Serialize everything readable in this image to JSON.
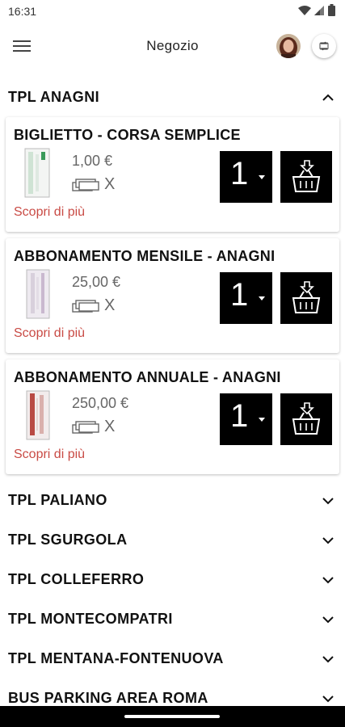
{
  "status": {
    "time": "16:31"
  },
  "header": {
    "title": "Negozio"
  },
  "expanded_section": {
    "title": "TPL ANAGNI",
    "products": [
      {
        "title": "BIGLIETTO - CORSA SEMPLICE",
        "price": "1,00 €",
        "stock_mark": "X",
        "more": "Scopri di più",
        "qty": "1",
        "thumb": "ticket-single"
      },
      {
        "title": "ABBONAMENTO MENSILE - ANAGNI",
        "price": "25,00 €",
        "stock_mark": "X",
        "more": "Scopri di più",
        "qty": "1",
        "thumb": "ticket-monthly"
      },
      {
        "title": "ABBONAMENTO ANNUALE - ANAGNI",
        "price": "250,00 €",
        "stock_mark": "X",
        "more": "Scopri di più",
        "qty": "1",
        "thumb": "ticket-annual"
      }
    ]
  },
  "sections": [
    {
      "title": "TPL PALIANO"
    },
    {
      "title": "TPL SGURGOLA"
    },
    {
      "title": "TPL COLLEFERRO"
    },
    {
      "title": "TPL MONTECOMPATRI"
    },
    {
      "title": "TPL MENTANA-FONTENUOVA"
    },
    {
      "title": "BUS PARKING AREA ROMA"
    }
  ],
  "colors": {
    "accent_link": "#c94b45",
    "button_bg": "#000000",
    "text": "#111111"
  }
}
